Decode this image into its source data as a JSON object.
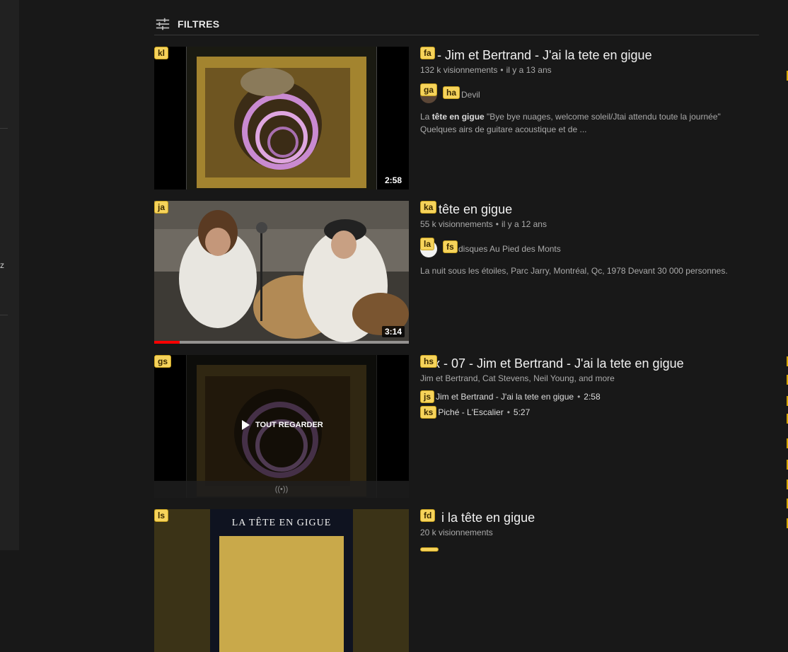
{
  "filters": {
    "label": "FILTRES",
    "icon": "filter-sliders-icon"
  },
  "results": [
    {
      "badge_thumb": "kl",
      "badge_title": "fa",
      "title": "- Jim et Bertrand - J'ai la tete en gigue",
      "views": "132 k visionnements",
      "age": "il y a 13 ans",
      "channel_badge_avatar": "ga",
      "channel_badge_name": "ha",
      "channel": "Devil",
      "desc_prefix": "La ",
      "desc_bold": "tête en gigue",
      "desc_rest": " \"Bye bye nuages, welcome soleil/Jtai attendu toute la journée\" Quelques airs de guitare acoustique et de ...",
      "duration": "2:58"
    },
    {
      "badge_thumb": "ja",
      "badge_title": "ka",
      "title": "tête en gigue",
      "views": "55 k visionnements",
      "age": "il y a 12 ans",
      "channel_badge_avatar": "la",
      "channel_badge_name": "fs",
      "channel": "disques Au Pied des Monts",
      "desc": "La nuit sous les étoiles, Parc Jarry, Montréal, Qc, 1978 Devant 30 000 personnes.",
      "duration": "3:14",
      "progress": 0.1
    },
    {
      "badge_thumb": "gs",
      "badge_title": "hs",
      "title": "Mix - 07 - Jim et Bertrand - J'ai la tete en gigue",
      "artists": "Jim et Bertrand, Cat Stevens, Neil Young, and more",
      "play_all": "TOUT REGARDER",
      "live_icon": "((•))",
      "items": [
        {
          "badge": "js",
          "title": "Jim et Bertrand - J'ai la tete en gigue",
          "duration": "2:58"
        },
        {
          "badge": "ks",
          "title": "Piché - L'Escalier",
          "duration": "5:27"
        }
      ]
    },
    {
      "badge_thumb": "ls",
      "badge_title": "fd",
      "title": "i la tête en gigue",
      "views": "20 k visionnements",
      "thumb_text": "LA TÊTE EN GIGUE"
    }
  ],
  "colors": {
    "background": "#181818",
    "badge": "#f6d35b",
    "progress": "#ff0000"
  }
}
